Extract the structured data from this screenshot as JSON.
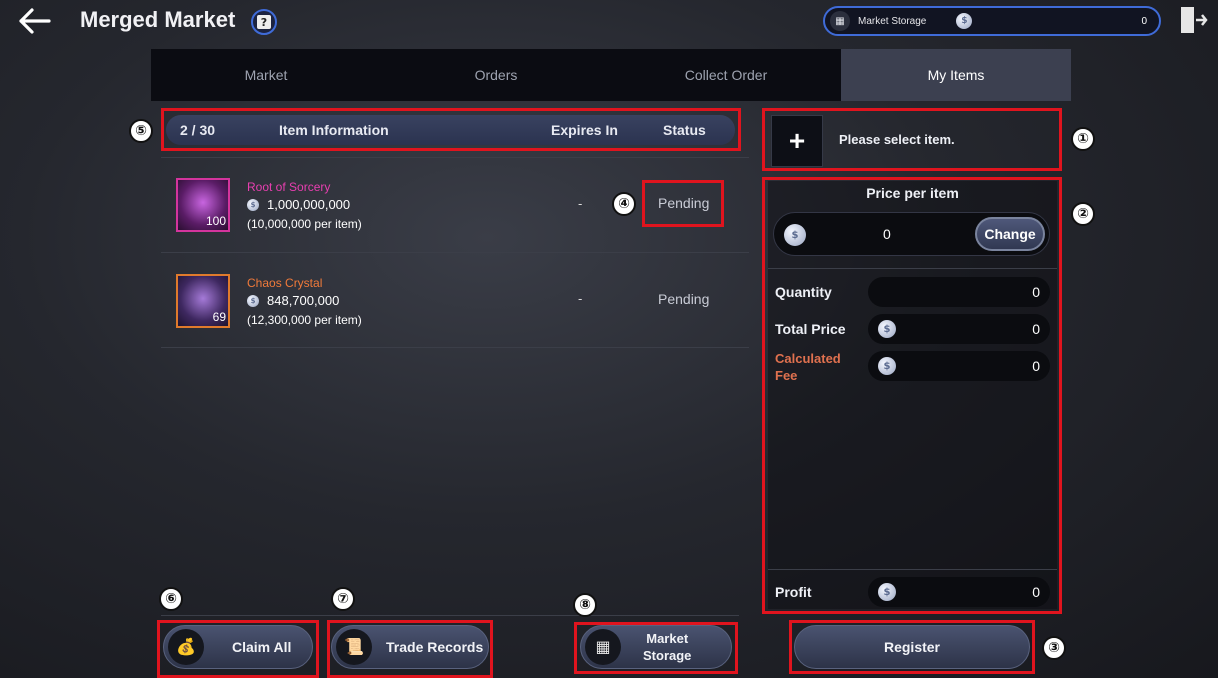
{
  "header": {
    "title": "Merged Market",
    "storage_label": "Market Storage",
    "storage_value": "0"
  },
  "tabs": [
    {
      "label": "Market"
    },
    {
      "label": "Orders"
    },
    {
      "label": "Collect Order"
    },
    {
      "label": "My Items"
    }
  ],
  "list": {
    "count": "2 / 30",
    "col_item": "Item Information",
    "col_expires": "Expires In",
    "col_status": "Status",
    "items": [
      {
        "name": "Root of Sorcery",
        "price": "1,000,000,000",
        "per_item": "(10,000,000 per item)",
        "qty": "100",
        "expires": "-",
        "status": "Pending",
        "name_color": "#e83fb0"
      },
      {
        "name": "Chaos Crystal",
        "price": "848,700,000",
        "per_item": "(12,300,000 per item)",
        "qty": "69",
        "expires": "-",
        "status": "Pending",
        "name_color": "#f07a3a"
      }
    ]
  },
  "register": {
    "select_prompt": "Please select item.",
    "price_per_item_title": "Price per item",
    "price_value": "0",
    "change_label": "Change",
    "quantity_label": "Quantity",
    "quantity_value": "0",
    "total_price_label": "Total Price",
    "total_price_value": "0",
    "fee_label_1": "Calculated",
    "fee_label_2": "Fee",
    "fee_value": "0",
    "profit_label": "Profit",
    "profit_value": "0",
    "register_label": "Register"
  },
  "bottom": {
    "claim_all": "Claim All",
    "trade_records": "Trade Records",
    "market_storage_1": "Market",
    "market_storage_2": "Storage"
  },
  "annotations": [
    "①",
    "②",
    "③",
    "④",
    "⑤",
    "⑥",
    "⑦",
    "⑧"
  ]
}
